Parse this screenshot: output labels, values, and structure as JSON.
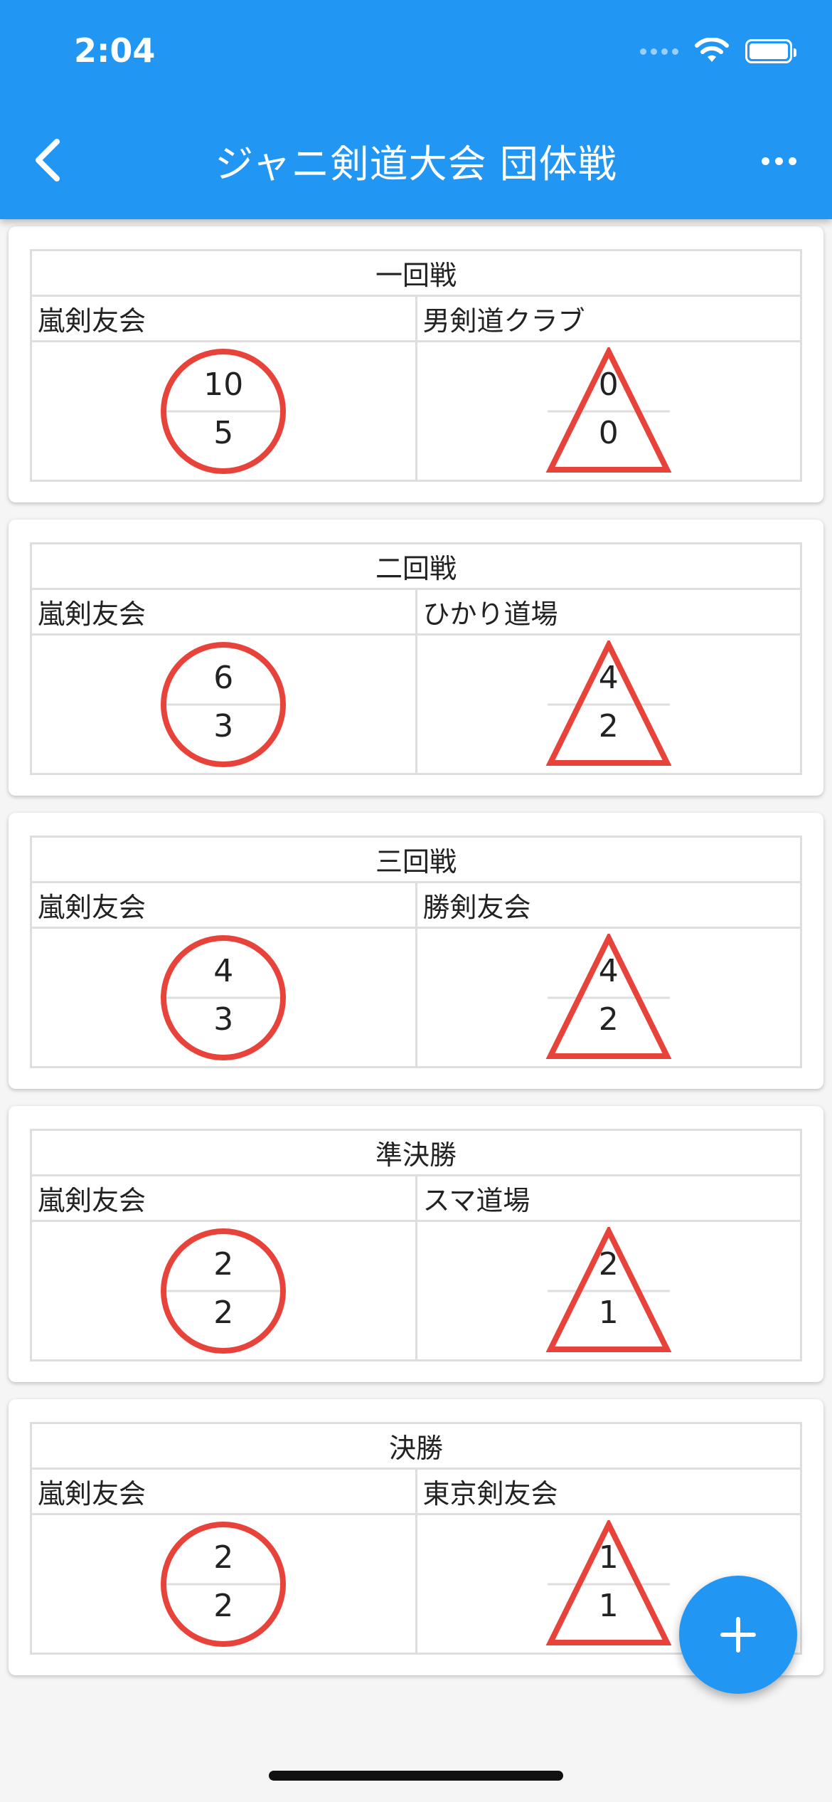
{
  "status_bar": {
    "time": "2:04"
  },
  "app_bar": {
    "title": "ジャニ剣道大会 団体戦",
    "back_icon": "chevron-left-icon",
    "menu_icon": "more-horizontal-icon"
  },
  "colors": {
    "primary": "#2196f3",
    "mark": "#e8433b"
  },
  "bouts": [
    {
      "round": "一回戦",
      "home": {
        "name": "嵐剣友会",
        "wins": "10",
        "points": "5"
      },
      "away": {
        "name": "男剣道クラブ",
        "wins": "0",
        "points": "0"
      }
    },
    {
      "round": "二回戦",
      "home": {
        "name": "嵐剣友会",
        "wins": "6",
        "points": "3"
      },
      "away": {
        "name": "ひかり道場",
        "wins": "4",
        "points": "2"
      }
    },
    {
      "round": "三回戦",
      "home": {
        "name": "嵐剣友会",
        "wins": "4",
        "points": "3"
      },
      "away": {
        "name": "勝剣友会",
        "wins": "4",
        "points": "2"
      }
    },
    {
      "round": "準決勝",
      "home": {
        "name": "嵐剣友会",
        "wins": "2",
        "points": "2"
      },
      "away": {
        "name": "スマ道場",
        "wins": "2",
        "points": "1"
      }
    },
    {
      "round": "決勝",
      "home": {
        "name": "嵐剣友会",
        "wins": "2",
        "points": "2"
      },
      "away": {
        "name": "東京剣友会",
        "wins": "1",
        "points": "1"
      }
    }
  ],
  "fab": {
    "icon": "plus-icon"
  }
}
